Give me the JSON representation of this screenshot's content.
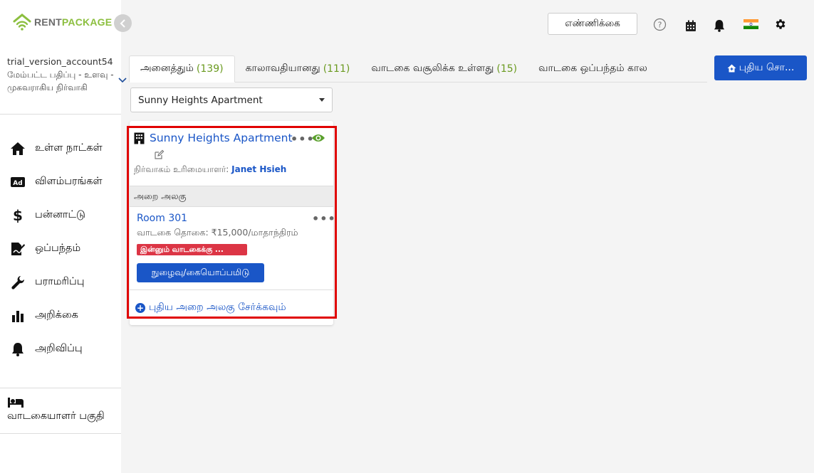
{
  "brand": {
    "part1": "RENT",
    "part2": "PACKAGE"
  },
  "account": {
    "name": "trial_version_account54",
    "role": "மேம்பட்ட பதிப்பு - உளவு - முகவராகிய நிர்வாகி"
  },
  "sidebar": {
    "items": [
      {
        "label": "உள்ள நாட்கள்",
        "icon": "home-icon"
      },
      {
        "label": "விளம்பரங்கள்",
        "icon": "ad-icon"
      },
      {
        "label": "பன்னாட்டு",
        "icon": "dollar-icon"
      },
      {
        "label": "ஒப்பந்தம்",
        "icon": "contract-icon"
      },
      {
        "label": "பராமரிப்பு",
        "icon": "wrench-icon"
      },
      {
        "label": "அறிக்கை",
        "icon": "bar-chart-icon"
      },
      {
        "label": "அறிவிப்பு",
        "icon": "bell-icon"
      }
    ],
    "tenant_section": "வாடகையாளர் பகுதி"
  },
  "topbar": {
    "count_button": "எண்ணிக்கை",
    "icons": [
      "help-icon",
      "calendar-icon",
      "bell-icon",
      "india-flag-icon",
      "gear-icon"
    ]
  },
  "tabs": [
    {
      "label": "அனைத்தும்",
      "count": "(139)"
    },
    {
      "label": "காலாவதியானது",
      "count": "(111)"
    },
    {
      "label": "வாடகை வசூலிக்க உள்ளது",
      "count": "(15)"
    },
    {
      "label": "வாடகை ஒப்பந்தம் கால",
      "count": ""
    }
  ],
  "new_button": "புதிய சொ...",
  "property_select": {
    "value": "Sunny Heights Apartment"
  },
  "card": {
    "title": "Sunny Heights Apartment",
    "owner_label": "நிர்வாகம் உரிமையாளர்:",
    "owner_name": "Janet Hsieh",
    "unit_header": "அறை அலகு",
    "room": "Room 301",
    "rent": "வாடகை தொகை: ₹15,000/மாதாந்திரம்",
    "badge": "இன்னும் வாடகைக்கு ...",
    "checkin_button": "நுழைவு/கையொப்பமிடு",
    "add_unit": "புதிய அறை அலகு சேர்க்கவும்"
  },
  "colors": {
    "primary": "#1a56c7",
    "brand_green": "#8cbf3f",
    "danger": "#dc3545",
    "highlight": "#e00000",
    "eye_green": "#5aa02c"
  }
}
